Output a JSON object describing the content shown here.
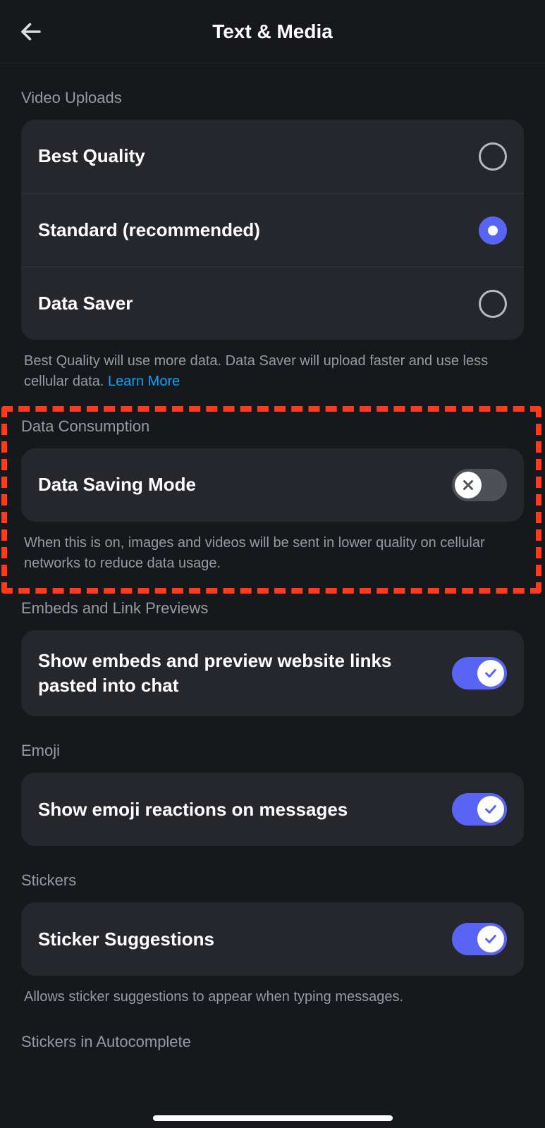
{
  "header": {
    "title": "Text & Media"
  },
  "sections": {
    "video_uploads": {
      "header": "Video Uploads",
      "options": {
        "best": "Best Quality",
        "standard": "Standard (recommended)",
        "saver": "Data Saver"
      },
      "selected": "standard",
      "caption_pre": "Best Quality will use more data. Data Saver will upload faster and use less cellular data. ",
      "caption_link": "Learn More"
    },
    "data_consumption": {
      "header": "Data Consumption",
      "row_label": "Data Saving Mode",
      "enabled": false,
      "caption": "When this is on, images and videos will be sent in lower quality on cellular networks to reduce data usage."
    },
    "embeds": {
      "header": "Embeds and Link Previews",
      "row_label": "Show embeds and preview website links pasted into chat",
      "enabled": true
    },
    "emoji": {
      "header": "Emoji",
      "row_label": "Show emoji reactions on messages",
      "enabled": true
    },
    "stickers": {
      "header": "Stickers",
      "row_label": "Sticker Suggestions",
      "enabled": true,
      "caption": "Allows sticker suggestions to appear when typing messages."
    },
    "stickers_autocomplete": {
      "header": "Stickers in Autocomplete"
    }
  },
  "annotation": {
    "color": "#ff3b1f"
  }
}
